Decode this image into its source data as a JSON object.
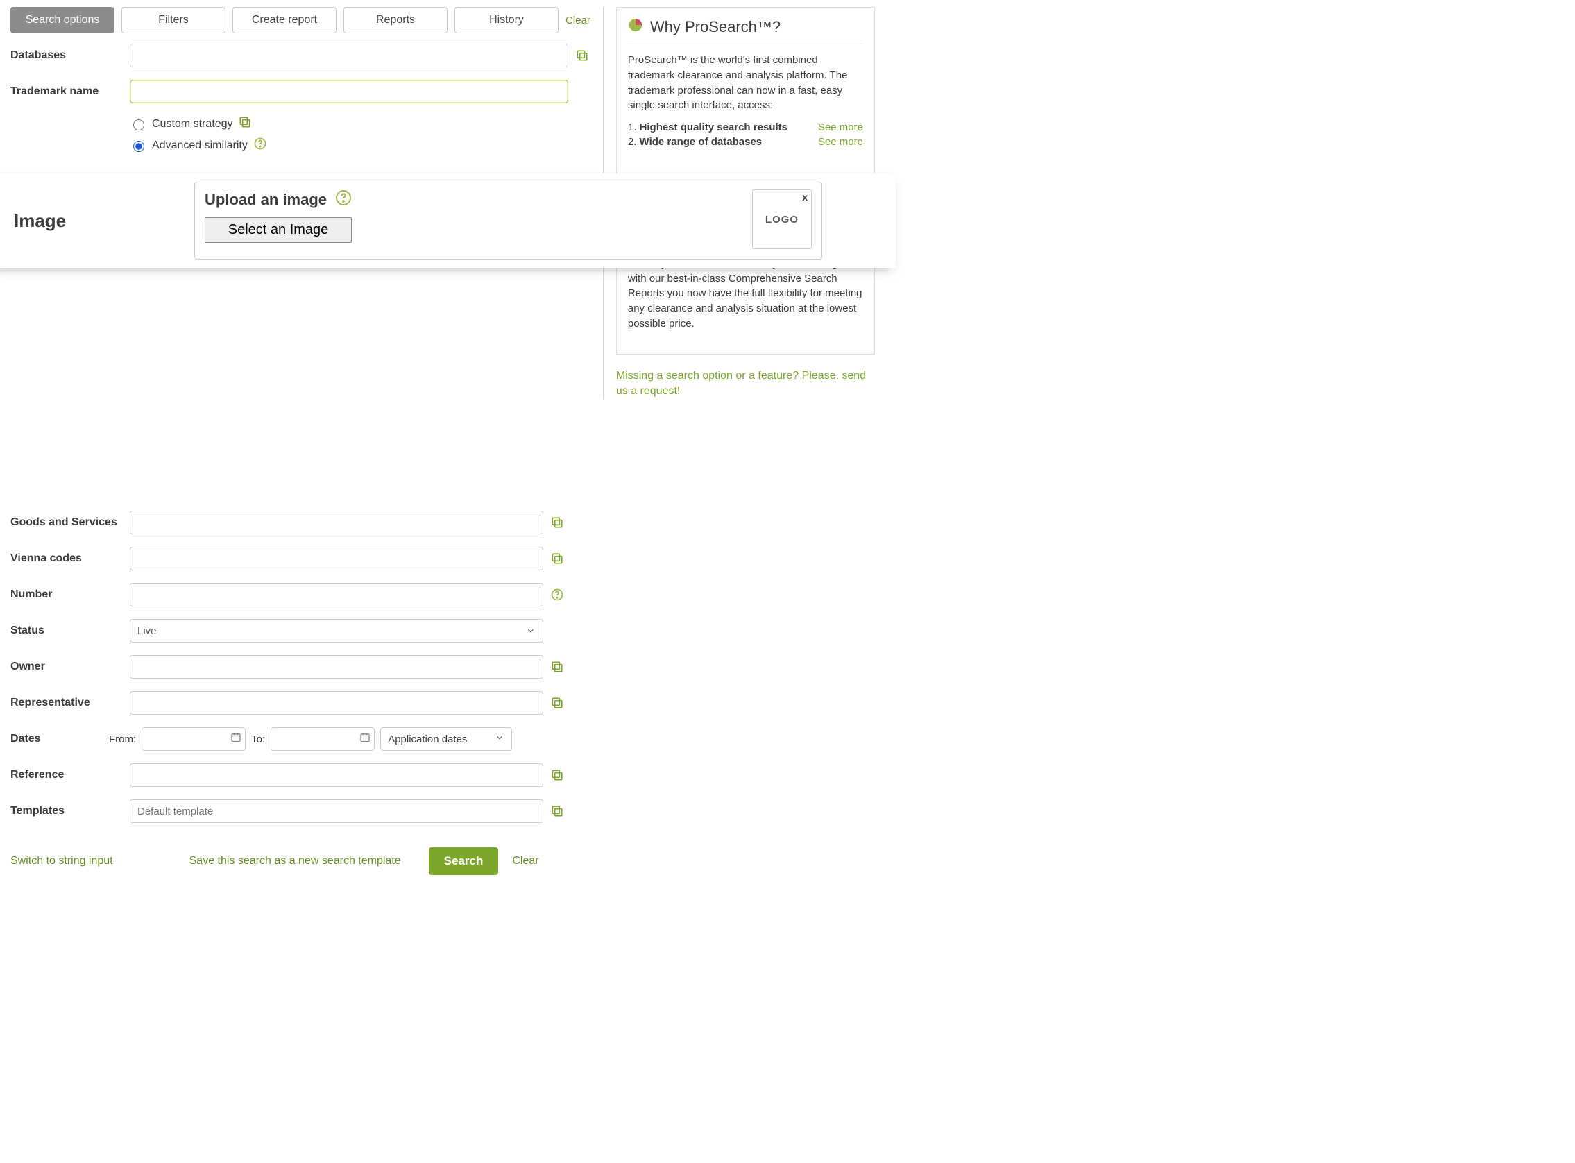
{
  "tabs": {
    "search_options": "Search options",
    "filters": "Filters",
    "create_report": "Create report",
    "reports": "Reports",
    "history": "History",
    "clear": "Clear"
  },
  "form": {
    "databases_label": "Databases",
    "trademark_label": "Trademark name",
    "strategy": {
      "custom": "Custom strategy",
      "advanced": "Advanced similarity"
    },
    "image_label": "Image",
    "upload_title": "Upload an image",
    "select_image_btn": "Select an Image",
    "logo_placeholder": "LOGO",
    "goods_label": "Goods and Services",
    "vienna_label": "Vienna codes",
    "number_label": "Number",
    "status_label": "Status",
    "status_value": "Live",
    "owner_label": "Owner",
    "rep_label": "Representative",
    "dates_label": "Dates",
    "from_label": "From:",
    "to_label": "To:",
    "date_type_value": "Application dates",
    "reference_label": "Reference",
    "templates_label": "Templates",
    "templates_placeholder": "Default template"
  },
  "bottom": {
    "switch": "Switch to string input",
    "save_template": "Save this search as a new search template",
    "search": "Search",
    "clear": "Clear"
  },
  "right": {
    "title": "Why ProSearch™?",
    "intro": "ProSearch™ is the world's first combined trademark clearance and analysis platform. The trademark professional can now in a fast, easy single search interface, access:",
    "feat1_num": "1.",
    "feat1": "Highest quality search results",
    "feat2_num": "2.",
    "feat2": "Wide range of databases",
    "see_more": "See more",
    "para2": "The ProSearch™ platform is meant to handle the bulk of your clearance and analysis work. Together with our best-in-class Comprehensive Search Reports you now have the full flexibility for meeting any clearance and analysis situation at the lowest possible price.",
    "request_link": "Missing a search option or a feature? Please, send us a request!"
  }
}
